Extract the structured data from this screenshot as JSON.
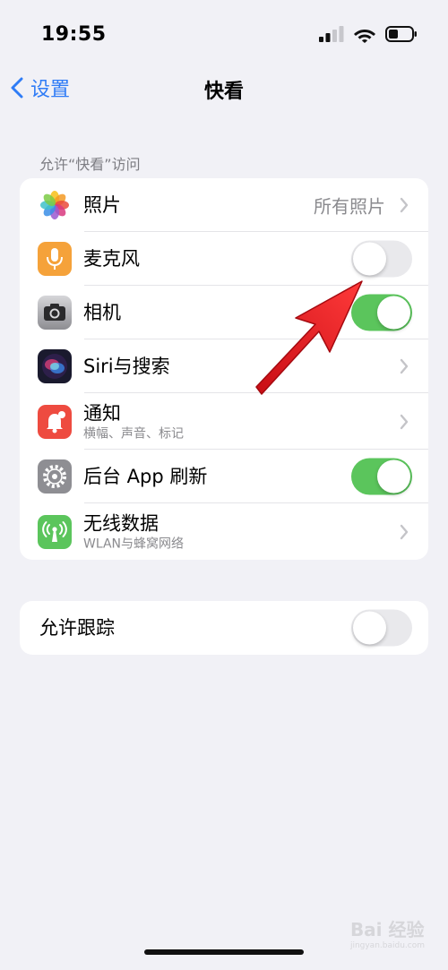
{
  "status_bar": {
    "time": "19:55"
  },
  "nav": {
    "back_label": "设置",
    "title": "快看"
  },
  "section_header": "允许“快看”访问",
  "permissions": [
    {
      "label": "照片",
      "value": "所有照片",
      "control": "chevron",
      "icon": "photos-icon",
      "icon_color": "#ffffff"
    },
    {
      "label": "麦克风",
      "control": "toggle",
      "on": false,
      "icon": "microphone-icon",
      "icon_color": "#f5a23a"
    },
    {
      "label": "相机",
      "control": "toggle",
      "on": true,
      "icon": "camera-icon",
      "icon_color": "#555559"
    },
    {
      "label": "Siri与搜索",
      "control": "chevron",
      "icon": "siri-icon",
      "icon_color": "#1a1a2e"
    },
    {
      "label": "通知",
      "sublabel": "横幅、声音、标记",
      "control": "chevron",
      "icon": "notification-icon",
      "icon_color": "#ee4b40"
    },
    {
      "label": "后台 App 刷新",
      "control": "toggle",
      "on": true,
      "icon": "gear-icon",
      "icon_color": "#8e8e93"
    },
    {
      "label": "无线数据",
      "sublabel": "WLAN与蜂窝网络",
      "control": "chevron",
      "icon": "antenna-icon",
      "icon_color": "#5bc55c"
    }
  ],
  "tracking": {
    "label": "允许跟踪",
    "on": false
  },
  "watermark": {
    "text": "Bai 经验",
    "url": "jingyan.baidu.com"
  },
  "colors": {
    "accent": "#2f7cf6",
    "toggle_on": "#5bc55c",
    "background": "#f1f1f6",
    "annotation_arrow": "#e8141c"
  }
}
